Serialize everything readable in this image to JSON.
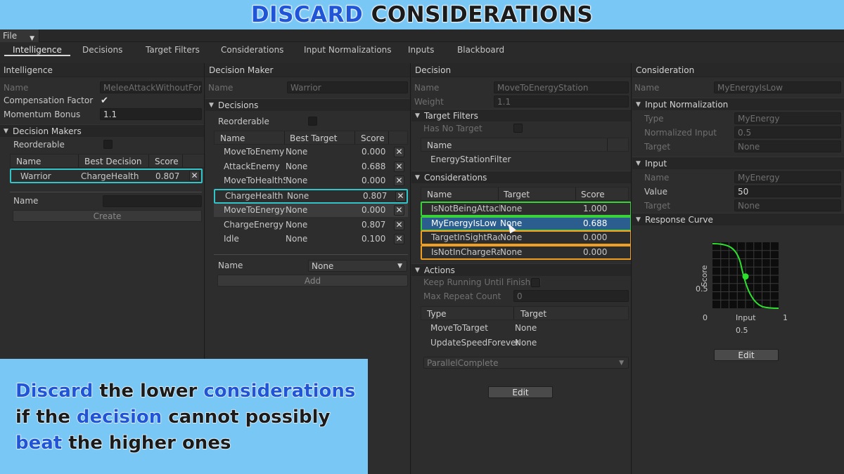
{
  "banner": {
    "word1": "DISCARD",
    "word2": "CONSIDERATIONS"
  },
  "menu": {
    "file": "File",
    "file_caret": "▼"
  },
  "tabs": [
    "Intelligence",
    "Decisions",
    "Target Filters",
    "Considerations",
    "Input Normalizations",
    "Inputs",
    "Blackboard"
  ],
  "intelligence": {
    "header": "Intelligence",
    "name_label": "Name",
    "name_value": "MeleeAttackWithoutForce",
    "comp_label": "Compensation Factor",
    "momentum_label": "Momentum Bonus",
    "momentum_value": "1.1",
    "decision_makers_section": "Decision Makers",
    "reorderable_label": "Reorderable",
    "col_name": "Name",
    "col_best": "Best Decision",
    "col_score": "Score",
    "row": {
      "name": "Warrior",
      "best": "ChargeHealth",
      "score": "0.807",
      "remove": "✕"
    },
    "create_name_label": "Name",
    "create_button": "Create"
  },
  "decision_maker": {
    "header": "Decision Maker",
    "name_label": "Name",
    "name_value": "Warrior",
    "decisions_section": "Decisions",
    "reorderable_label": "Reorderable",
    "col_name": "Name",
    "col_target": "Best Target",
    "col_score": "Score",
    "rows": [
      {
        "name": "MoveToEnemy",
        "target": "None",
        "score": "0.000",
        "remove": "✕"
      },
      {
        "name": "AttackEnemy",
        "target": "None",
        "score": "0.688",
        "remove": "✕"
      },
      {
        "name": "MoveToHealthSt",
        "target": "None",
        "score": "0.000",
        "remove": "✕"
      },
      {
        "name": "ChargeHealth",
        "target": "None",
        "score": "0.807",
        "remove": "✕"
      },
      {
        "name": "MoveToEnergyS",
        "target": "None",
        "score": "0.000",
        "remove": "✕"
      },
      {
        "name": "ChargeEnergy",
        "target": "None",
        "score": "0.807",
        "remove": "✕"
      },
      {
        "name": "Idle",
        "target": "None",
        "score": "0.100",
        "remove": "✕"
      }
    ],
    "add_name_label": "Name",
    "add_dropdown": "None",
    "add_button": "Add"
  },
  "decision": {
    "header": "Decision",
    "name_label": "Name",
    "name_value": "MoveToEnergyStation",
    "weight_label": "Weight",
    "weight_value": "1.1",
    "target_filters_section": "Target Filters",
    "has_no_target_label": "Has No Target",
    "filter_col_name": "Name",
    "filter_row": "EnergyStationFilter",
    "considerations_section": "Considerations",
    "col_name": "Name",
    "col_target": "Target",
    "col_score": "Score",
    "rows": [
      {
        "name": "IsNotBeingAttacke",
        "target": "None",
        "score": "1.000"
      },
      {
        "name": "MyEnergyIsLow",
        "target": "None",
        "score": "0.688"
      },
      {
        "name": "TargetInSightRadi",
        "target": "None",
        "score": "0.000"
      },
      {
        "name": "IsNotInChargeRad",
        "target": "None",
        "score": "0.000"
      }
    ],
    "actions_section": "Actions",
    "keep_running_label": "Keep Running Until Finished",
    "max_repeat_label": "Max Repeat Count",
    "max_repeat_value": "0",
    "action_col_type": "Type",
    "action_col_target": "Target",
    "action_rows": [
      {
        "type": "MoveToTarget",
        "target": "None"
      },
      {
        "type": "UpdateSpeedForever",
        "target": "None"
      }
    ],
    "completion_dropdown": "ParallelComplete",
    "edit_button": "Edit"
  },
  "consideration": {
    "header": "Consideration",
    "name_label": "Name",
    "name_value": "MyEnergyIsLow",
    "input_norm_section": "Input Normalization",
    "type_label": "Type",
    "type_value": "MyEnergy",
    "normalized_label": "Normalized Input",
    "normalized_value": "0.5",
    "target_label": "Target",
    "target_value": "None",
    "input_section": "Input",
    "input_name_label": "Name",
    "input_name_value": "MyEnergy",
    "value_label": "Value",
    "value_value": "50",
    "input_target_label": "Target",
    "input_target_value": "None",
    "curve_section": "Response Curve",
    "curve_ylabel": "Score",
    "curve_y_mid": "0.5",
    "curve_x0": "0",
    "curve_xlabel": "Input",
    "curve_x1": "1",
    "curve_x_mid": "0.5",
    "edit_button": "Edit"
  },
  "caption": {
    "l1a": "Discard",
    "l1b": " the lower ",
    "l1c": "considerations",
    "l2a": "if the ",
    "l2b": "decision",
    "l2c": " cannot possibly",
    "l3a": "beat",
    "l3b": " the higher ones"
  },
  "colors": {
    "highlight_cyan": "#31c4c8",
    "highlight_green": "#3ad23a",
    "highlight_orange": "#f0a020",
    "selection_blue": "#2c5d8f",
    "curve_green": "#2ee02e"
  }
}
